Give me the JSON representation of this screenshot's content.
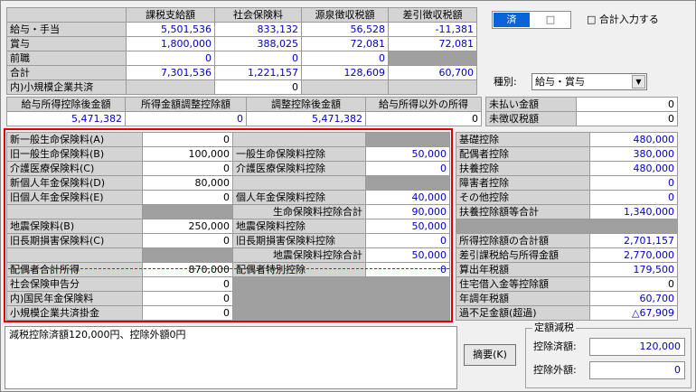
{
  "summary": {
    "headers": [
      "課税支給額",
      "社会保険料",
      "源泉徴収税額",
      "差引徴収税額"
    ],
    "rows": [
      {
        "label": "給与・手当",
        "values": [
          "5,501,536",
          "833,132",
          "56,528",
          "-11,381"
        ]
      },
      {
        "label": "賞与",
        "values": [
          "1,800,000",
          "388,025",
          "72,081",
          "72,081"
        ]
      },
      {
        "label": "前職",
        "values": [
          "0",
          "0",
          "0",
          ""
        ]
      },
      {
        "label": "合計",
        "values": [
          "7,301,536",
          "1,221,157",
          "128,609",
          "60,700"
        ]
      },
      {
        "label": "内)小規模企業共済",
        "values": [
          "",
          "0",
          "",
          ""
        ]
      }
    ]
  },
  "toggle": {
    "on_label": "済",
    "off_label": "□"
  },
  "checkbox": {
    "label": "合計入力する",
    "mark": "□"
  },
  "kind": {
    "label": "種別:",
    "value": "給与・賞与",
    "arrow": "▼"
  },
  "income": {
    "headers": [
      "給与所得控除後金額",
      "所得金額調整控除額",
      "調整控除後金額",
      "給与所得以外の所得"
    ],
    "values": [
      "5,471,382",
      "0",
      "5,471,382",
      "0"
    ]
  },
  "unpaid": [
    {
      "label": "未払い金額",
      "value": "0"
    },
    {
      "label": "未徴収税額",
      "value": "0"
    }
  ],
  "insurance_left": [
    {
      "label": "新一般生命保険料(A)",
      "value": "0"
    },
    {
      "label": "旧一般生命保険料(B)",
      "value": "100,000"
    },
    {
      "label": "介護医療保険料(C)",
      "value": "0"
    },
    {
      "label": "新個人年金保険料(D)",
      "value": "80,000"
    },
    {
      "label": "旧個人年金保険料(E)",
      "value": "0"
    },
    {
      "label": "",
      "value": ""
    },
    {
      "label": "地震保険料(B)",
      "value": "250,000"
    },
    {
      "label": "旧長期損害保険料(C)",
      "value": "0"
    },
    {
      "label": "",
      "value": ""
    },
    {
      "label": "配偶者合計所得",
      "value": "870,000"
    },
    {
      "label": "社会保険申告分",
      "value": "0"
    },
    {
      "label": "内)国民年金保険料",
      "value": "0"
    },
    {
      "label": "小規模企業共済掛金",
      "value": "0"
    }
  ],
  "insurance_right": [
    {
      "label": "",
      "value": ""
    },
    {
      "label": "一般生命保険料控除",
      "value": "50,000"
    },
    {
      "label": "介護医療保険料控除",
      "value": "0"
    },
    {
      "label": "",
      "value": ""
    },
    {
      "label": "個人年金保険料控除",
      "value": "40,000"
    },
    {
      "label": "生命保険料控除合計",
      "value": "90,000"
    },
    {
      "label": "地震保険料控除",
      "value": "50,000"
    },
    {
      "label": "旧長期損害保険料控除",
      "value": "0"
    },
    {
      "label": "地震保険料控除合計",
      "value": "50,000"
    },
    {
      "label": "配偶者特別控除",
      "value": "0"
    }
  ],
  "deductions": [
    {
      "label": "基礎控除",
      "value": "480,000"
    },
    {
      "label": "配偶者控除",
      "value": "380,000"
    },
    {
      "label": "扶養控除",
      "value": "480,000"
    },
    {
      "label": "障害者控除",
      "value": "0"
    },
    {
      "label": "その他控除",
      "value": "0"
    },
    {
      "label": "扶養控除額等合計",
      "value": "1,340,000"
    },
    {
      "label": "",
      "value": ""
    },
    {
      "label": "所得控除額の合計額",
      "value": "2,701,157"
    },
    {
      "label": "差引課税給与所得金額",
      "value": "2,770,000"
    },
    {
      "label": "算出年税額",
      "value": "179,500"
    },
    {
      "label": "住宅借入金等控除額",
      "value": "0"
    },
    {
      "label": "年調年税額",
      "value": "60,700"
    },
    {
      "label": "過不足金額(超過)",
      "value": "△67,909"
    }
  ],
  "memo": {
    "text": "減税控除済額120,000円、控除外額0円"
  },
  "summary_button": {
    "label": "摘要(K)"
  },
  "fixed_tax": {
    "title": "定額減税",
    "deducted_label": "控除済額:",
    "deducted_value": "120,000",
    "excluded_label": "控除外額:",
    "excluded_value": "0"
  }
}
